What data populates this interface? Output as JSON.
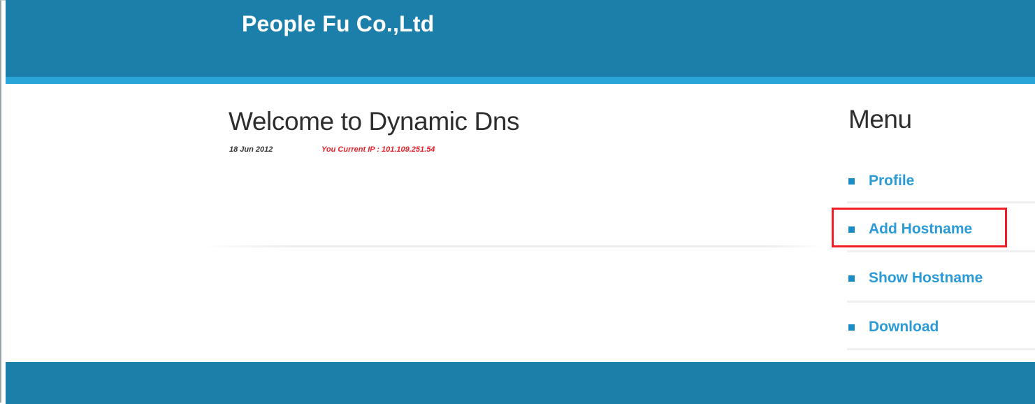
{
  "header": {
    "brand": "People Fu Co.,Ltd"
  },
  "main": {
    "title": "Welcome to Dynamic Dns",
    "date": "18 Jun 2012",
    "current_ip": "You Current IP : 101.109.251.54"
  },
  "menu": {
    "title": "Menu",
    "items": [
      {
        "label": "Profile"
      },
      {
        "label": "Add Hostname"
      },
      {
        "label": "Show Hostname"
      },
      {
        "label": "Download"
      }
    ],
    "highlighted_item": "Add Hostname"
  },
  "colors": {
    "header_bg": "#1b7fa9",
    "header_strip": "#2aa5d7",
    "link": "#2a9bd6",
    "ip_text": "#e3222a",
    "highlight": "#f21d24"
  }
}
